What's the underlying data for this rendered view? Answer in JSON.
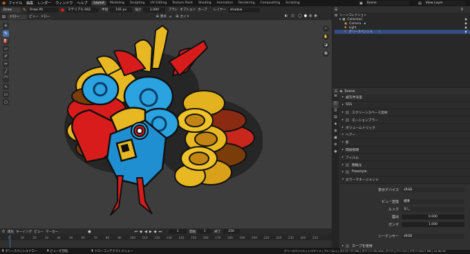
{
  "menubar": {
    "menus": [
      "ファイル",
      "編集",
      "レンダー",
      "ウィンドウ",
      "ヘルプ"
    ],
    "workspaces": [
      "Layout",
      "Modeling",
      "Sculpting",
      "UV Editing",
      "Texture Paint",
      "Shading",
      "Animation",
      "Rendering",
      "Compositing",
      "Scripting"
    ],
    "active_workspace": "Layout",
    "scene": "Scene",
    "view_layer": "View Layer"
  },
  "tool_header": {
    "mode": "Draw",
    "brush": "Draw Pit",
    "material": "マテリアル.002",
    "radius_label": "半径",
    "radius_value": "191 px",
    "strength_label": "強さ",
    "strength_value": "1.000",
    "brush_menu": "ブラシ",
    "options_menu": "オプション",
    "curve_menu": "カーブ",
    "layer_label": "レイヤー",
    "layer_value": "shadow"
  },
  "viewport_header": {
    "mode": "ドロー",
    "menus": [
      "ビュー",
      "ドロー"
    ],
    "origin_label": "原点",
    "guide_label": "ガイド"
  },
  "outliner": {
    "title": "シーンコレクション",
    "items": [
      "Collection",
      "Camera",
      "Light",
      "グリースペンシル"
    ]
  },
  "properties": {
    "object": "Scene",
    "sections": [
      "被写界深度",
      "SSS",
      "スクリーンスペース反射",
      "モーションブラー",
      "ボリュームトリック",
      "ヘアー",
      "影",
      "間接照明",
      "フィルム",
      "簡略化",
      "Freestyle",
      "カラーマネージメント"
    ],
    "display_device_label": "表示デバイス",
    "display_device": "sRGB",
    "view_transform_label": "ビュー変換",
    "view_transform": "標準",
    "look_label": "ルック",
    "look": "なし",
    "exposure_label": "露出",
    "exposure": "0.000",
    "gamma_label": "ガンマ",
    "gamma": "1.000",
    "sequencer_label": "シーケンサー",
    "sequencer": "sRGB",
    "use_curves": "カーブを使用"
  },
  "timeline": {
    "menus": [
      "再生",
      "キーイング",
      "ビュー",
      "マーカー"
    ],
    "current_frame": "1",
    "start_label": "開始",
    "start": "1",
    "end_label": "終了",
    "end": "250",
    "ticks": [
      "0",
      "10",
      "20",
      "30",
      "40",
      "50",
      "60",
      "70",
      "80",
      "90",
      "100",
      "110",
      "120",
      "130",
      "140",
      "150",
      "160",
      "170",
      "180",
      "190",
      "200",
      "210",
      "220",
      "230",
      "240",
      "250"
    ]
  },
  "statusbar": {
    "left": "グリースペンシルドロー",
    "mid1": "ビューを回転",
    "mid2": "ドローコンテクストメニュー",
    "right": "グリースペンシル | レイヤー:2 | フレーム:1 | ストローク:196 | ポイント:35,436 | オブジェクト:1/3 | メモリ:104.7 MB | v2.80.16"
  },
  "colors": {
    "accent": "#4772b3",
    "red": "#d81c1c",
    "yellow": "#f2c21a",
    "blue": "#2aa3e0",
    "dark_red": "#7a0d0d"
  }
}
